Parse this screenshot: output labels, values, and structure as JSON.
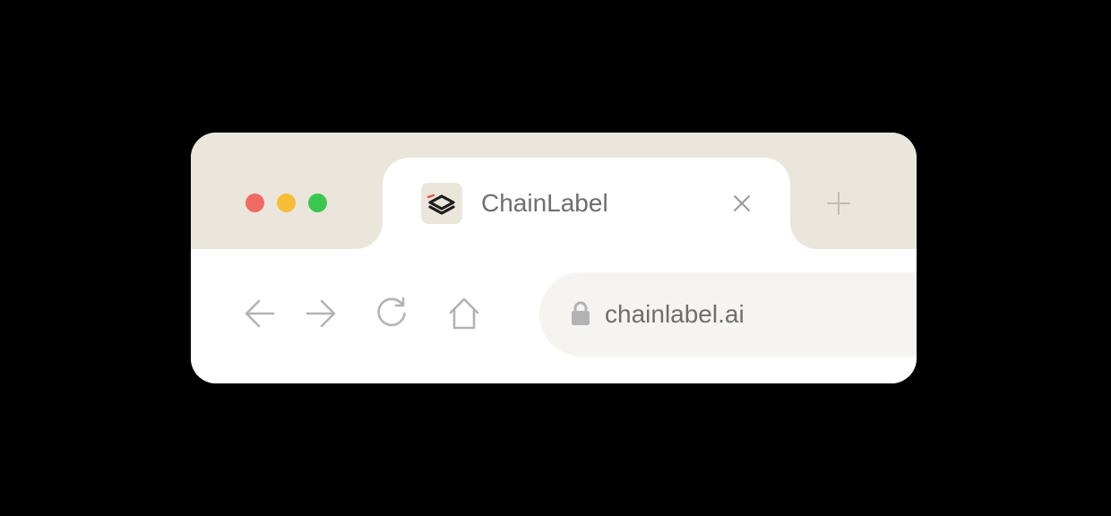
{
  "window": {
    "controls": [
      {
        "name": "close",
        "color": "#f26a64"
      },
      {
        "name": "minimize",
        "color": "#f7bd36"
      },
      {
        "name": "maximize",
        "color": "#3ac74f"
      }
    ]
  },
  "tab": {
    "title": "ChainLabel",
    "favicon_icon": "stacked-layers-logo",
    "close_icon": "close-icon"
  },
  "new_tab_icon": "plus-icon",
  "navigation": {
    "back_icon": "arrow-left-icon",
    "forward_icon": "arrow-right-icon",
    "reload_icon": "reload-icon",
    "home_icon": "home-icon"
  },
  "address_bar": {
    "url": "chainlabel.ai",
    "security_icon": "lock-icon"
  },
  "colors": {
    "chrome": "#ebe6dc",
    "tab_background": "#ffffff",
    "omnibox": "#f5f4f0",
    "text": "#6e6e6e",
    "icon": "#b3b3b3",
    "logo_dark": "#1c1c1c",
    "logo_accent": "#e8524a"
  }
}
